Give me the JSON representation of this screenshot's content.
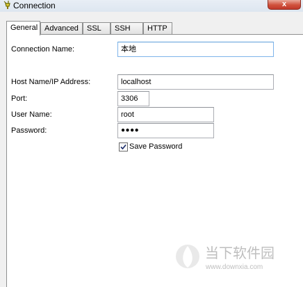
{
  "window": {
    "title": "Connection",
    "close_label": "x"
  },
  "tabs": [
    {
      "label": "General",
      "active": true
    },
    {
      "label": "Advanced",
      "active": false
    },
    {
      "label": "SSL",
      "active": false
    },
    {
      "label": "SSH",
      "active": false
    },
    {
      "label": "HTTP",
      "active": false
    }
  ],
  "form": {
    "connection_name": {
      "label": "Connection Name:",
      "value": "本地"
    },
    "host": {
      "label": "Host Name/IP Address:",
      "value": "localhost"
    },
    "port": {
      "label": "Port:",
      "value": "3306"
    },
    "username": {
      "label": "User Name:",
      "value": "root"
    },
    "password": {
      "label": "Password:",
      "value": "●●●●"
    },
    "save_password": {
      "label": "Save Password",
      "checked": true
    }
  },
  "watermark": {
    "brand": "当下软件园",
    "url": "www.downxia.com"
  },
  "icons": {
    "app": "navicat-connection-icon",
    "close": "close-icon",
    "check": "check-icon"
  }
}
